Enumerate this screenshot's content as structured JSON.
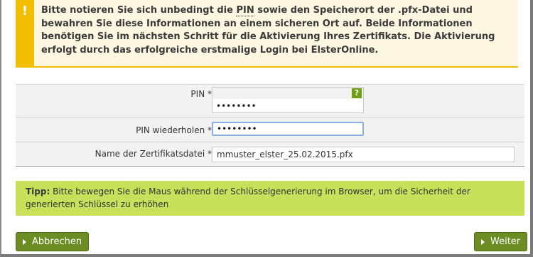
{
  "notice": {
    "icon": "exclamation-icon",
    "text_before": "Bitte notieren Sie sich unbedingt die ",
    "pin_word": "PIN",
    "text_after": " sowie den Speicherort der .pfx-Datei und bewahren Sie diese Informationen an einem sicheren Ort auf. Beide Informationen benötigen Sie im nächsten Schritt für die Aktivierung Ihres Zertifikats. Die Aktivierung erfolgt durch das erfolgreiche erstmalige Login bei ElsterOnline."
  },
  "form": {
    "pin": {
      "label": "PIN *",
      "value": "••••••••",
      "help_icon": "?"
    },
    "pin_repeat": {
      "label": "PIN wiederholen *",
      "value": "••••••••"
    },
    "filename": {
      "label": "Name der Zertifikatsdatei *",
      "value": "mmuster_elster_25.02.2015.pfx"
    }
  },
  "tip": {
    "label": "Tipp:",
    "text": " Bitte bewegen Sie die Maus während der Schlüsselgenerierung im Browser, um die Sicherheit der generierten Schlüssel zu erhöhen"
  },
  "buttons": {
    "cancel": "Abbrechen",
    "next": "Weiter"
  },
  "colors": {
    "notice_accent": "#f3be00",
    "tip_bg": "#c8e05a",
    "button_bg": "#6b8d24"
  }
}
